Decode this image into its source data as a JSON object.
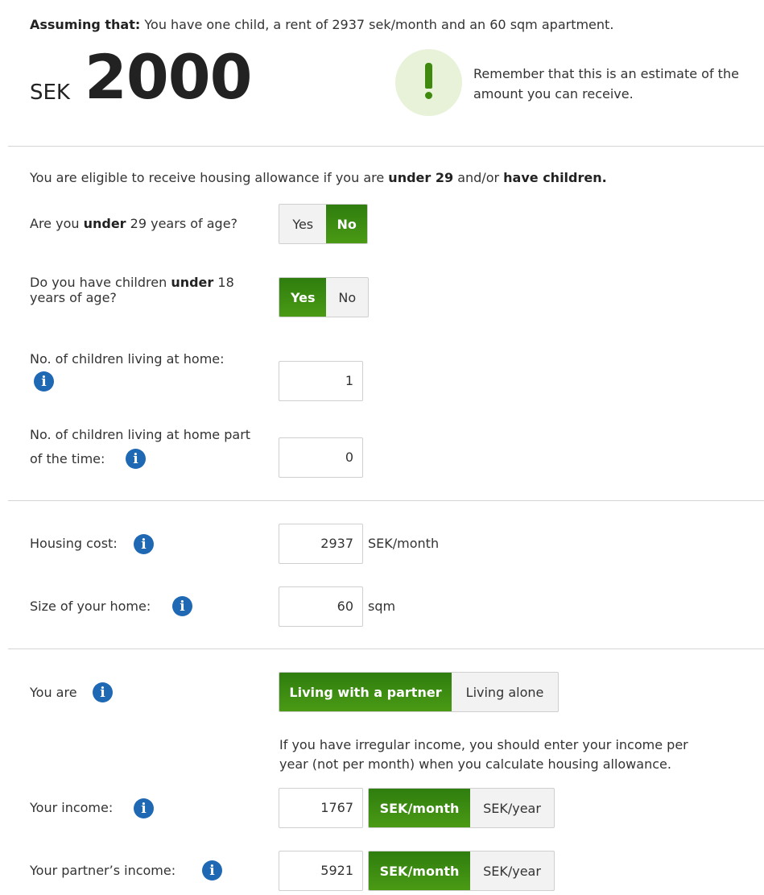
{
  "summary": {
    "assuming_label": "Assuming that:",
    "assuming_text": "You have one child, a rent of 2937 sek/month and an 60 sqm apartment.",
    "currency": "SEK",
    "amount": "2000",
    "reminder": "Remember that this is an estimate of the amount you can receive."
  },
  "eligibility": {
    "intro_pre": "You are eligible to receive housing allowance if you are",
    "intro_b1": "under 29",
    "intro_mid": "and/or",
    "intro_b2": "have children."
  },
  "q_age": {
    "pre": "Are you",
    "bold": "under",
    "post": "29 years of age?",
    "yes": "Yes",
    "no": "No",
    "selected": "No"
  },
  "q_children": {
    "pre": "Do you have children",
    "bold": "under",
    "post_line1": "18",
    "post_line2": "years of age?",
    "yes": "Yes",
    "no": "No",
    "selected": "Yes"
  },
  "children_home": {
    "label": "No. of children living at home:",
    "value": "1"
  },
  "children_part": {
    "label_line1": "No. of children living at home part",
    "label_line2": "of the time:",
    "value": "0"
  },
  "housing_cost": {
    "label": "Housing cost:",
    "value": "2937",
    "unit": "SEK/month"
  },
  "home_size": {
    "label": "Size of your home:",
    "value": "60",
    "unit": "sqm"
  },
  "living": {
    "label": "You are",
    "option_partner": "Living with a partner",
    "option_alone": "Living alone",
    "selected": "Living with a partner"
  },
  "income_note": {
    "line1": "If you have irregular income, you should enter your income per",
    "line2": "year (not per month) when you calculate housing allowance."
  },
  "your_income": {
    "label": "Your income:",
    "value": "1767",
    "opt_month": "SEK/month",
    "opt_year": "SEK/year",
    "selected": "SEK/month"
  },
  "partner_income": {
    "label": "Your partner’s income:",
    "value": "5921",
    "opt_month": "SEK/month",
    "opt_year": "SEK/year",
    "selected": "SEK/month"
  },
  "icons": {
    "info": "i",
    "warning": "!"
  },
  "colors": {
    "accent_green": "#3f8a0e",
    "info_blue": "#1f68b3",
    "warning_bg": "#e8f2d8"
  }
}
